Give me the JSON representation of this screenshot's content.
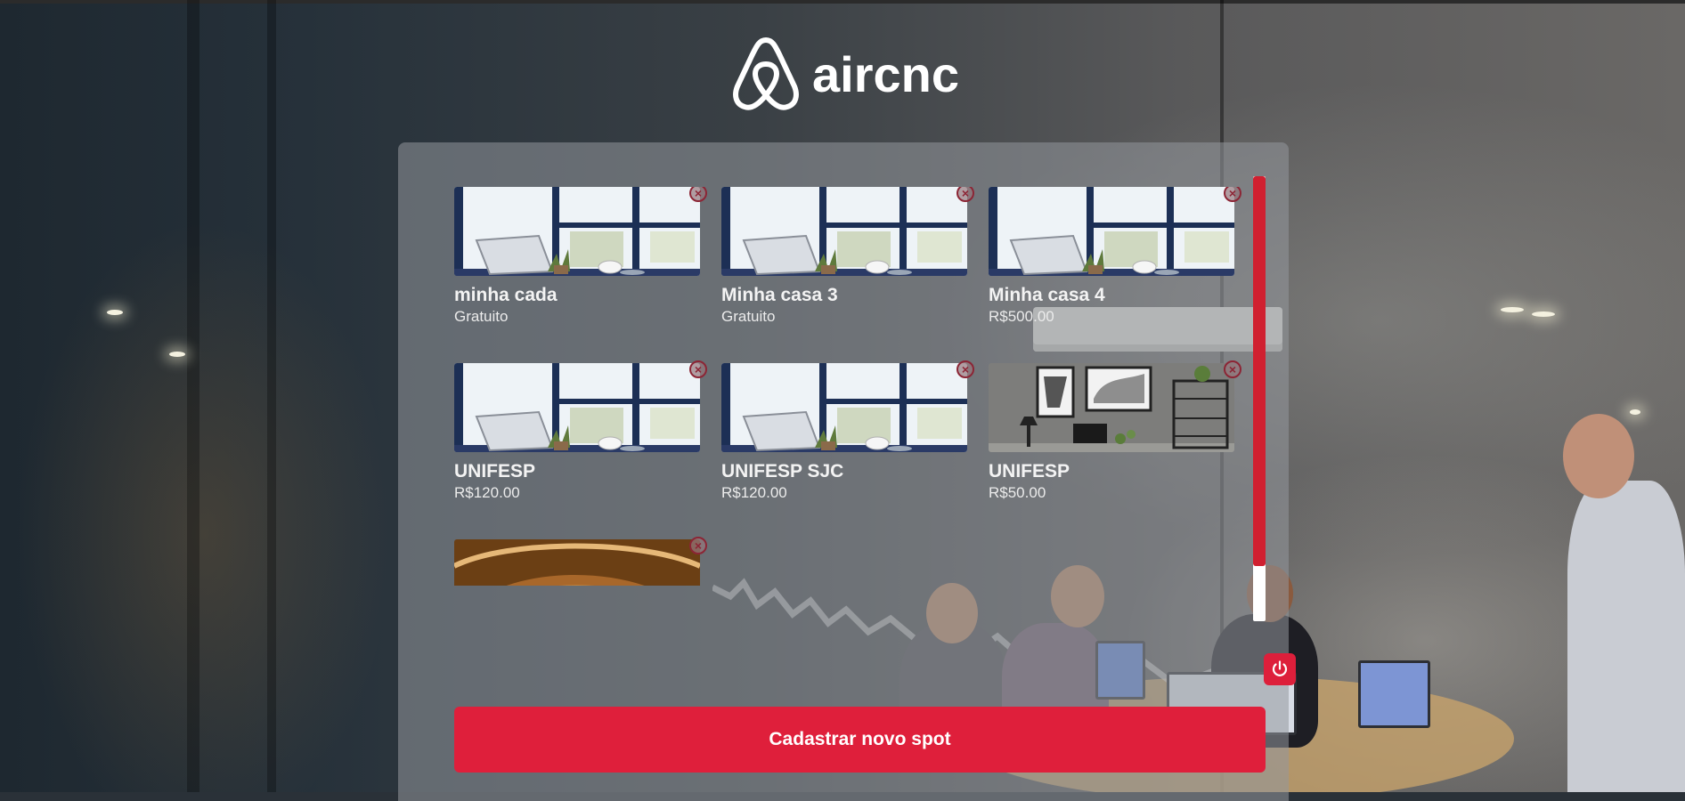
{
  "app": {
    "name": "aircnc"
  },
  "spots": [
    {
      "title": "minha cada",
      "price": "Gratuito",
      "image": "laptop-window-desk"
    },
    {
      "title": "Minha casa 3",
      "price": "Gratuito",
      "image": "laptop-window-desk"
    },
    {
      "title": "Minha casa 4",
      "price": "R$500.00",
      "image": "laptop-window-desk"
    },
    {
      "title": "UNIFESP",
      "price": "R$120.00",
      "image": "laptop-window-desk"
    },
    {
      "title": "UNIFESP SJC",
      "price": "R$120.00",
      "image": "laptop-window-desk"
    },
    {
      "title": "UNIFESP",
      "price": "R$50.00",
      "image": "gray-office-wall"
    },
    {
      "title": "",
      "price": "",
      "image": "wooden-arches"
    }
  ],
  "icons": {
    "delete": "close-icon",
    "logout": "power-icon"
  },
  "actions": {
    "new_spot": "Cadastrar novo spot"
  },
  "colors": {
    "accent": "#df1f3b",
    "scroll_thumb": "#d02030"
  }
}
